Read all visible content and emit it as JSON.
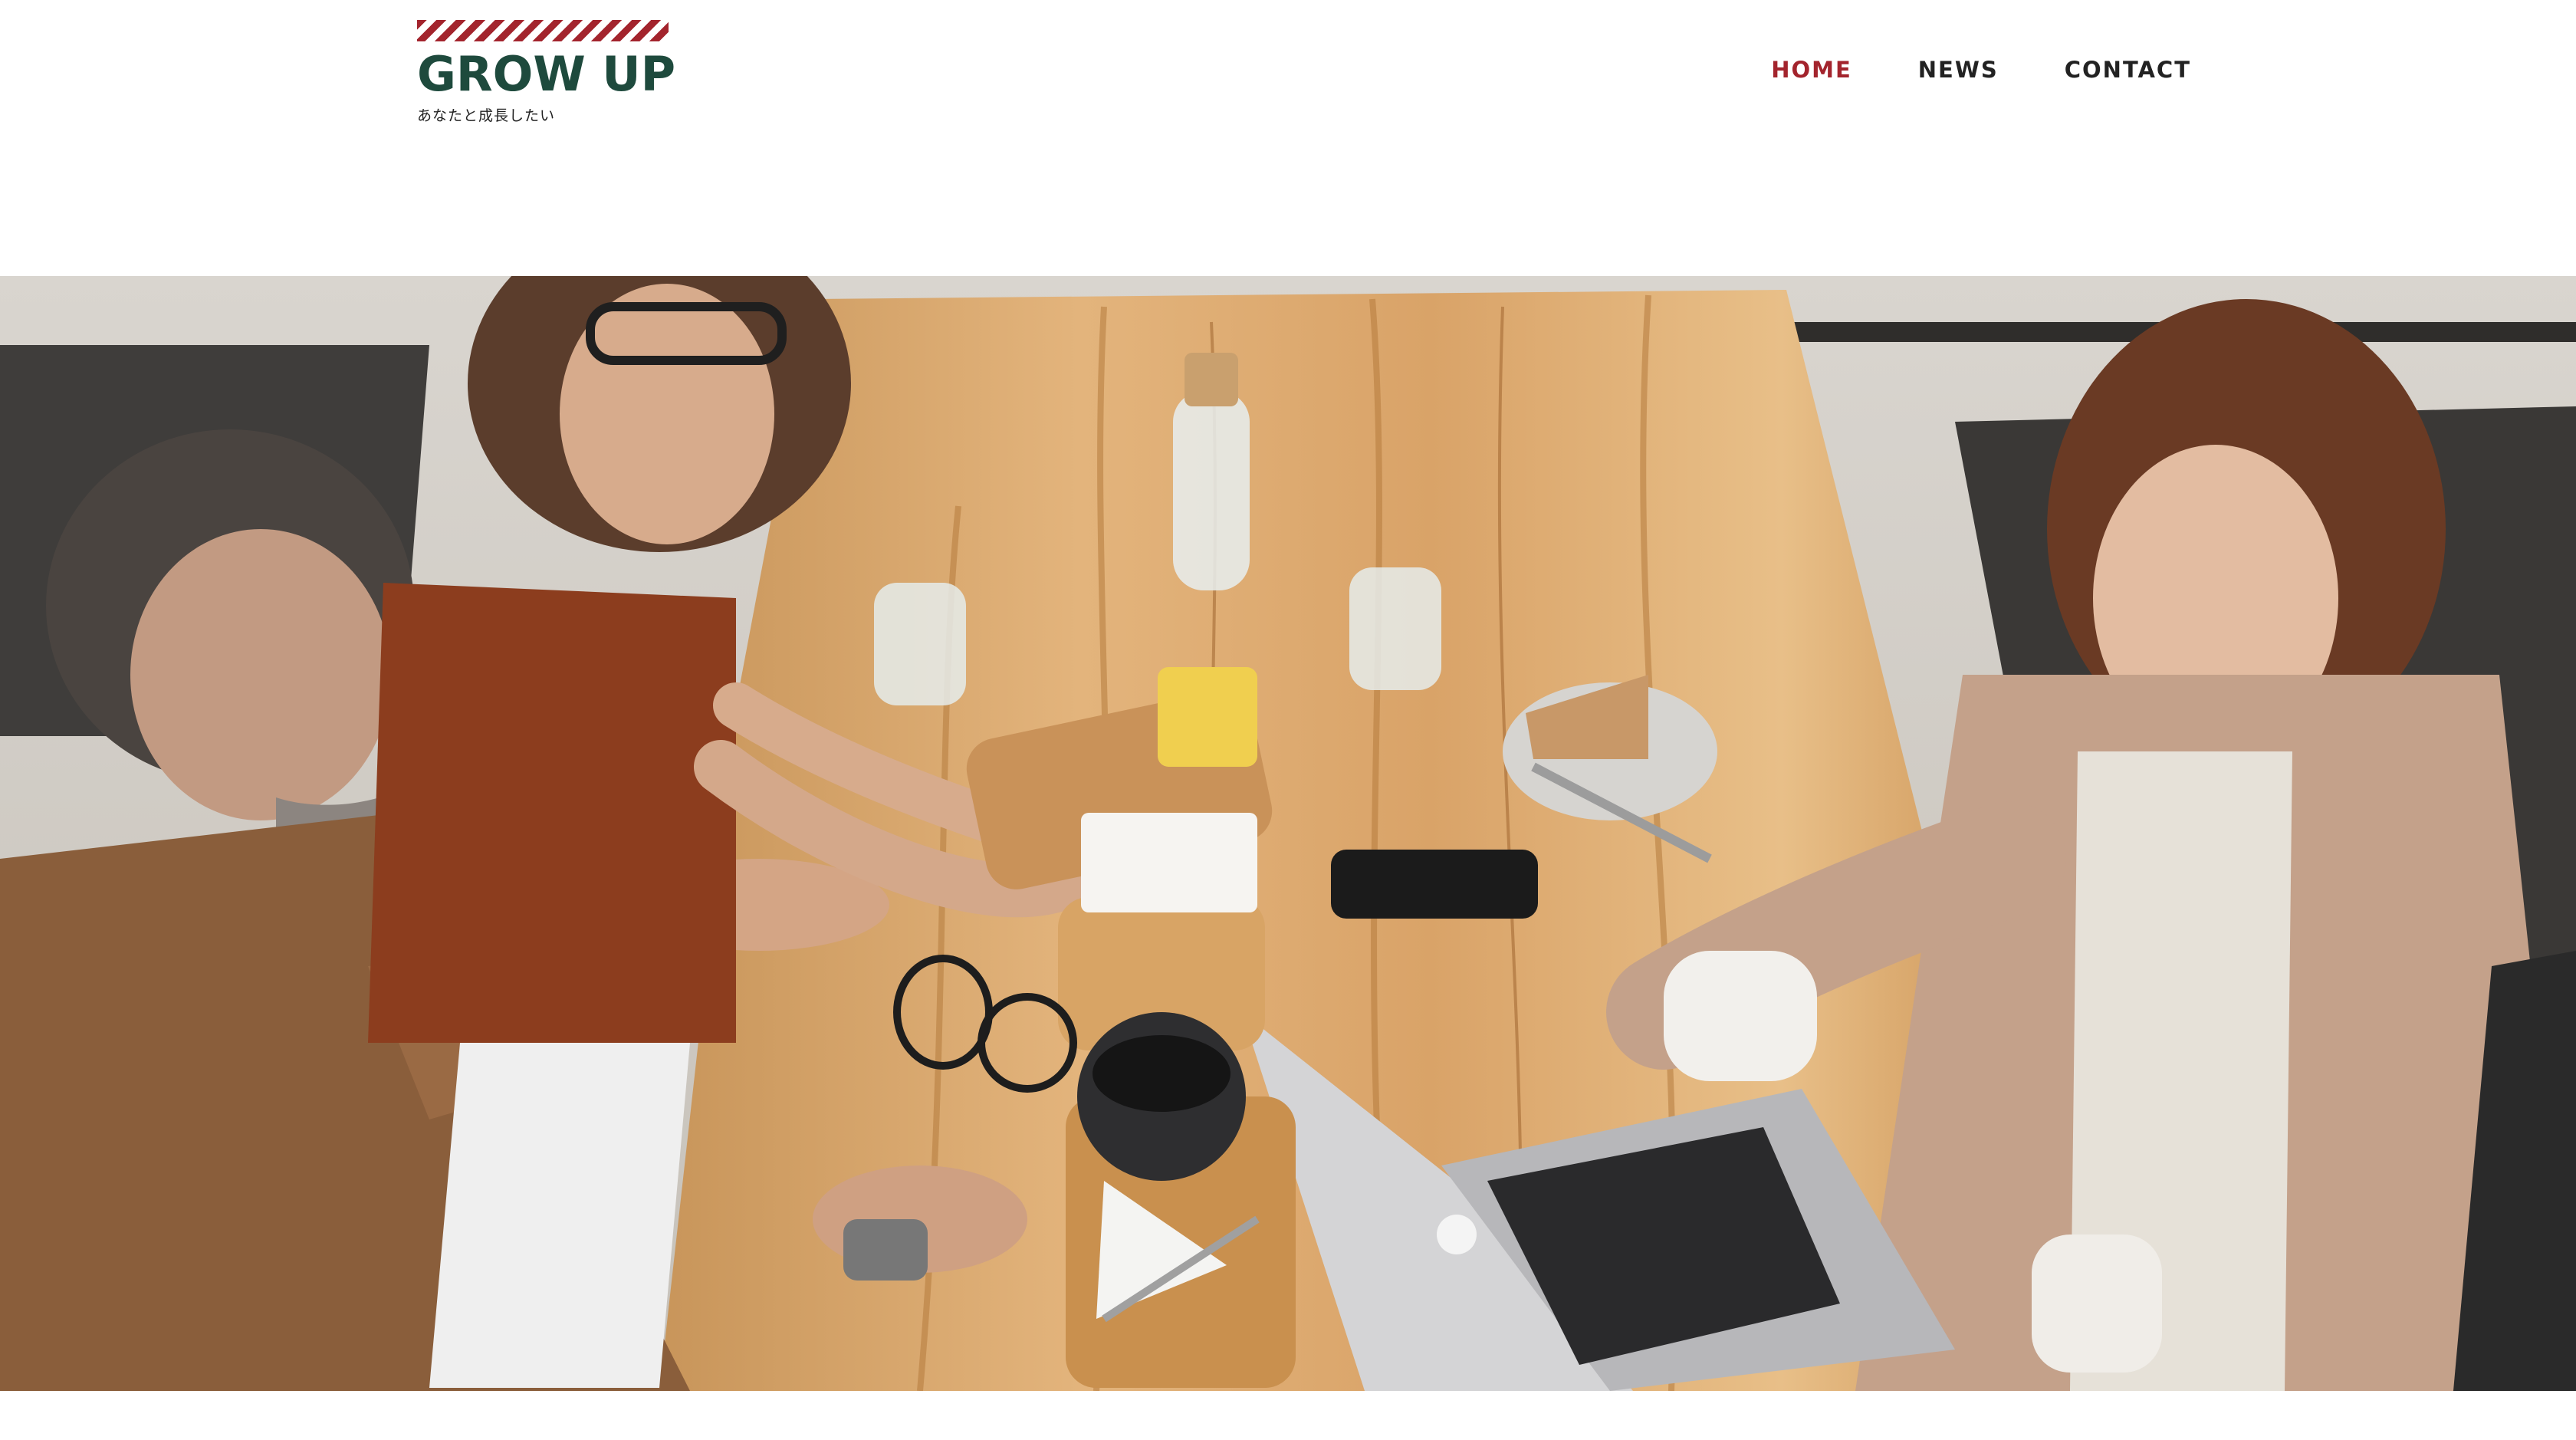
{
  "logo": {
    "title": "GROW UP",
    "tagline": "あなたと成長したい",
    "stripe_color": "#a3242d",
    "title_color": "#1e4a3d"
  },
  "nav": {
    "items": [
      {
        "label": "HOME",
        "active": true
      },
      {
        "label": "NEWS",
        "active": false
      },
      {
        "label": "CONTACT",
        "active": false
      }
    ],
    "active_color": "#a3242d"
  },
  "hero": {
    "image": "team-meeting-photo",
    "alt_subject": "people meeting at a wooden table with laptop, coffee and cake"
  }
}
